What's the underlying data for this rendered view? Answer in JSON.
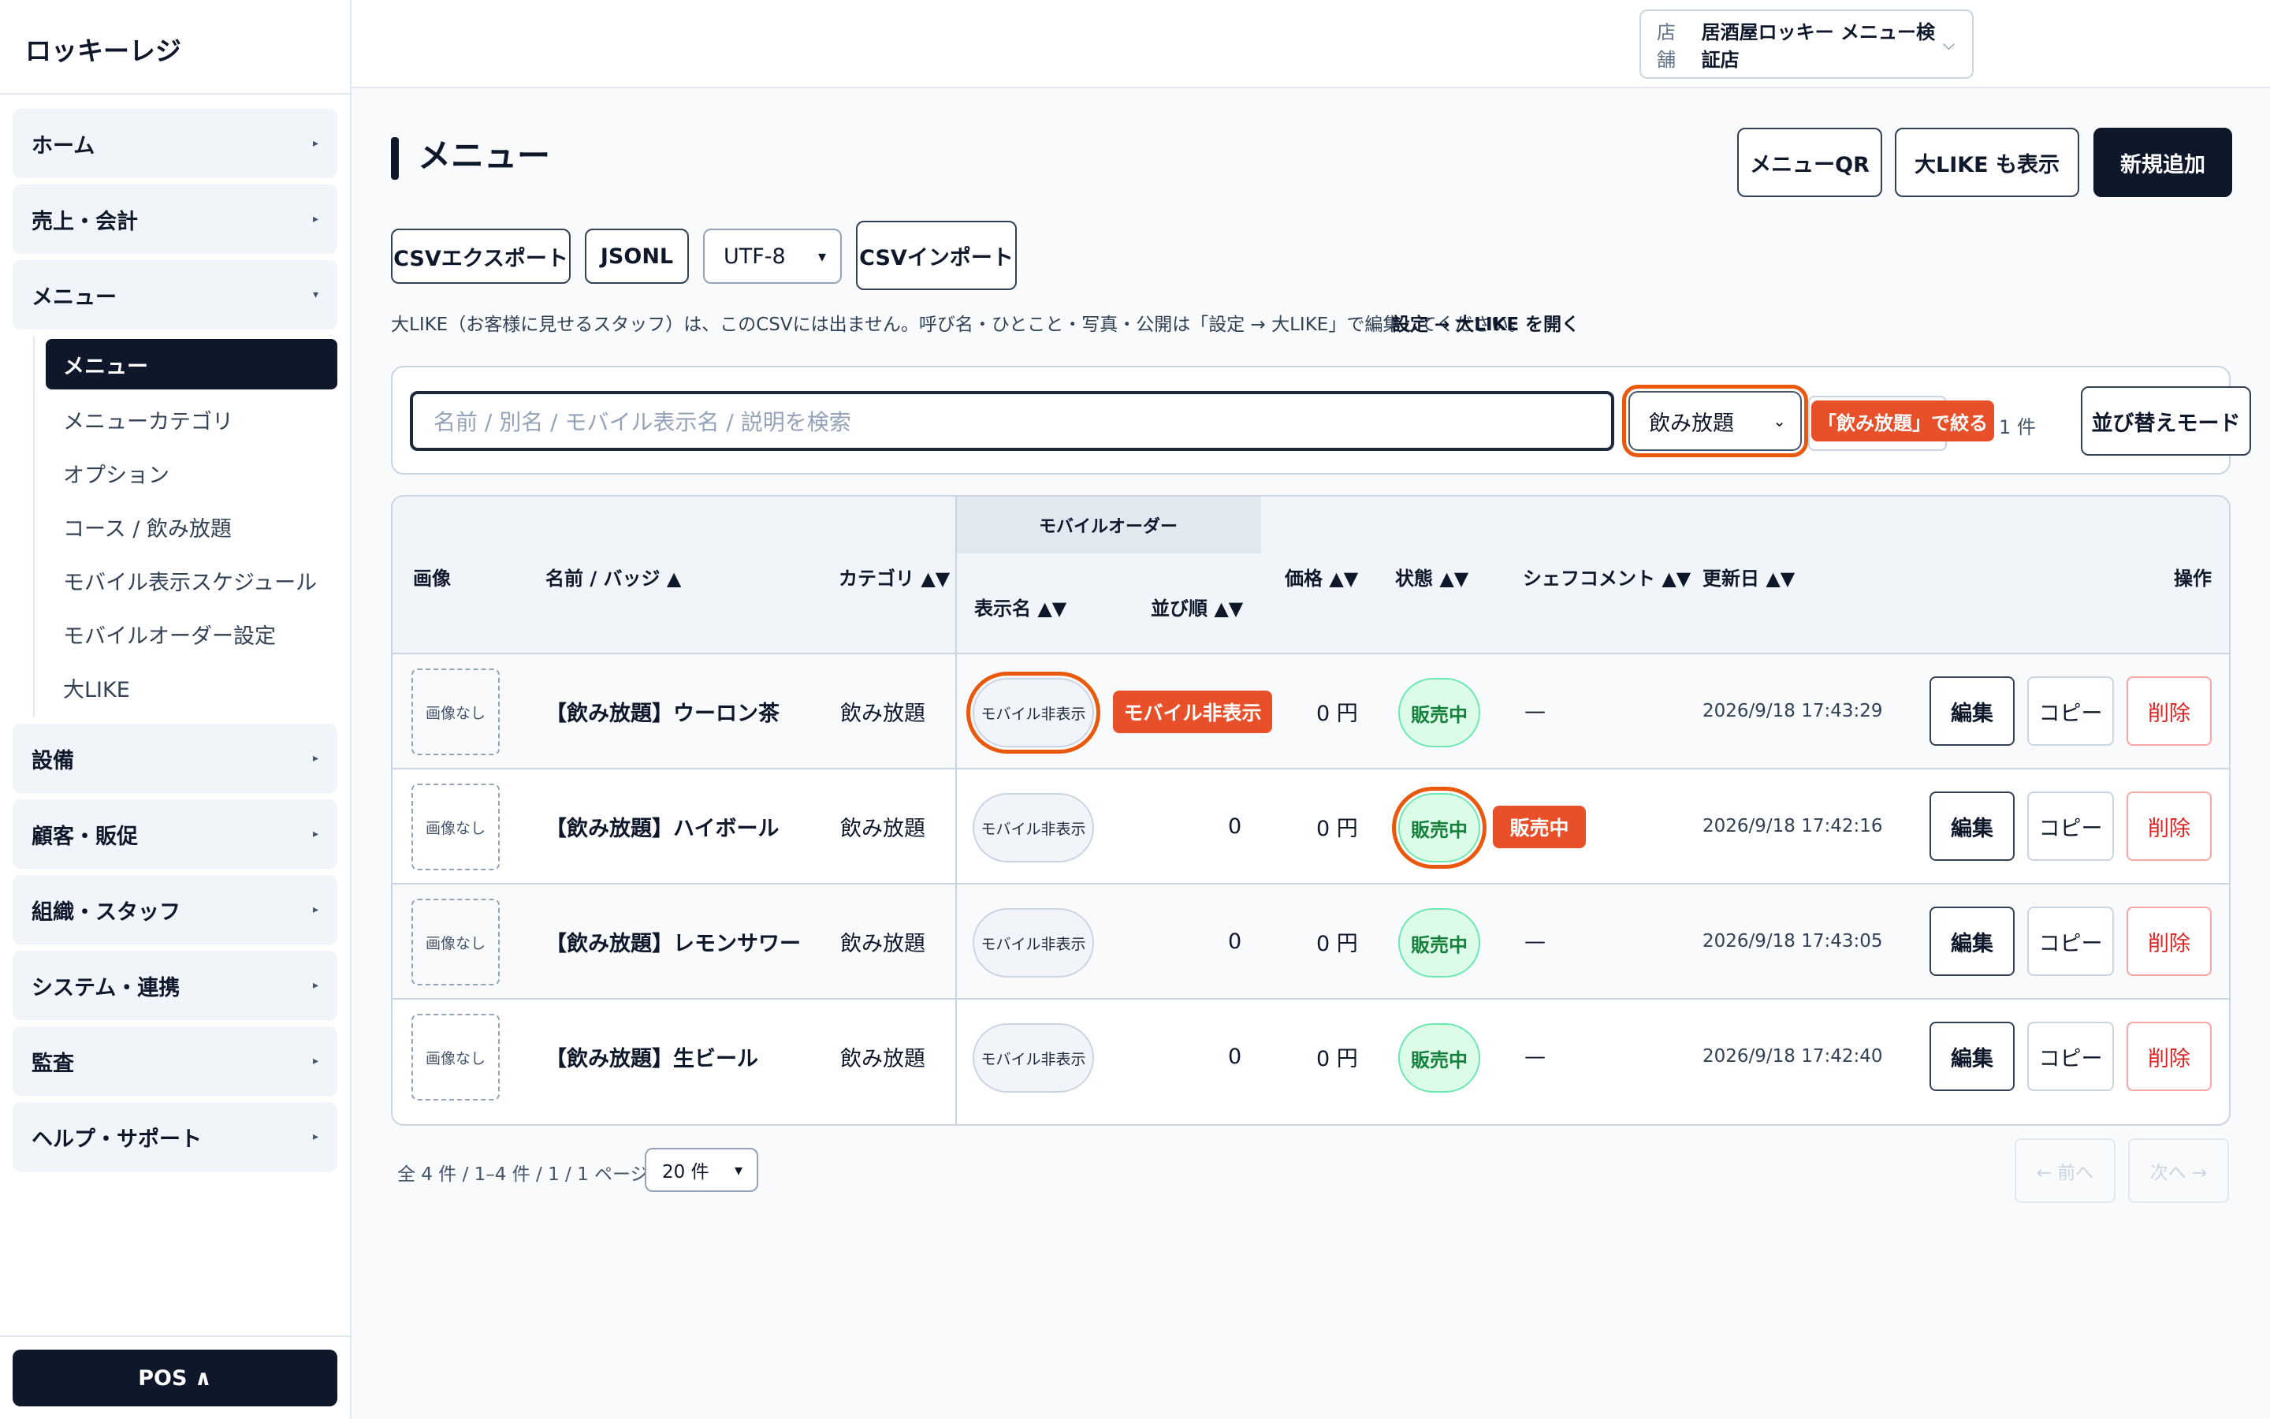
{
  "app": {
    "title": "ロッキーレジ"
  },
  "sidebar": {
    "groups": [
      {
        "label": "ホーム",
        "caret": "▸"
      },
      {
        "label": "売上・会計",
        "caret": "▸"
      },
      {
        "label": "メニュー",
        "caret": "▾"
      },
      {
        "label": "設備",
        "caret": "▸"
      },
      {
        "label": "顧客・販促",
        "caret": "▸"
      },
      {
        "label": "組織・スタッフ",
        "caret": "▸"
      },
      {
        "label": "システム・連携",
        "caret": "▸"
      },
      {
        "label": "監査",
        "caret": "▸"
      },
      {
        "label": "ヘルプ・サポート",
        "caret": "▸"
      }
    ],
    "menu_sub": [
      "メニュー",
      "メニューカテゴリ",
      "オプション",
      "コース / 飲み放題",
      "モバイル表示スケジュール",
      "モバイルオーダー設定",
      "大LIKE"
    ],
    "pos_label": "POS ∧"
  },
  "header": {
    "store_label": "店舗",
    "store_value": "居酒屋ロッキー メニュー検証店"
  },
  "page": {
    "title": "メニュー",
    "btn_qr": "メニューQR",
    "btn_like": "大LIKE も表示",
    "btn_new": "新規追加",
    "btn_csv_export": "CSVエクスポート",
    "btn_jsonl": "JSONL",
    "encoding": "UTF-8",
    "btn_csv_import": "CSVインポート",
    "note": "大LIKE（お客様に見せるスタッフ）は、このCSVには出ません。呼び名・ひとこと・写真・公開は「設定 → 大LIKE」で編集してください。",
    "note_link": "設定 → 大LIKE を開く"
  },
  "filter": {
    "search_placeholder": "名前 / 別名 / モバイル表示名 / 説明を検索",
    "category": "飲み放題",
    "tag": "「飲み放題」で絞る",
    "count": "1 件",
    "sort_mode": "並び替えモード"
  },
  "table": {
    "headers": {
      "image": "画像",
      "name": "名前 / バッジ ▲",
      "category": "カテゴリ ▲▼",
      "mobile_group": "モバイルオーダー",
      "display_name": "表示名 ▲▼",
      "order": "並び順 ▲▼",
      "price": "価格 ▲▼",
      "status": "状態 ▲▼",
      "chef": "シェフコメント ▲▼",
      "updated": "更新日 ▲▼",
      "actions": "操作"
    },
    "rows": [
      {
        "image": "画像なし",
        "name": "【飲み放題】ウーロン茶",
        "category": "飲み放題",
        "display": "モバイル非表示",
        "order": "",
        "price": "0 円",
        "status": "販売中",
        "chef": "—",
        "updated": "2026/9/18 17:43:29"
      },
      {
        "image": "画像なし",
        "name": "【飲み放題】ハイボール",
        "category": "飲み放題",
        "display": "モバイル非表示",
        "order": "0",
        "price": "0 円",
        "status": "販売中",
        "chef": "",
        "updated": "2026/9/18 17:42:16"
      },
      {
        "image": "画像なし",
        "name": "【飲み放題】レモンサワー",
        "category": "飲み放題",
        "display": "モバイル非表示",
        "order": "0",
        "price": "0 円",
        "status": "販売中",
        "chef": "—",
        "updated": "2026/9/18 17:43:05"
      },
      {
        "image": "画像なし",
        "name": "【飲み放題】生ビール",
        "category": "飲み放題",
        "display": "モバイル非表示",
        "order": "0",
        "price": "0 円",
        "status": "販売中",
        "chef": "—",
        "updated": "2026/9/18 17:42:40"
      }
    ],
    "actions": {
      "edit": "編集",
      "copy": "コピー",
      "delete": "削除"
    },
    "tooltip_mobile": "モバイル非表示",
    "tooltip_status": "販売中"
  },
  "pagination": {
    "info": "全 4 件 / 1–4 件 / 1 / 1 ページ",
    "per_page": "20 件",
    "prev": "← 前へ",
    "next": "次へ →"
  }
}
